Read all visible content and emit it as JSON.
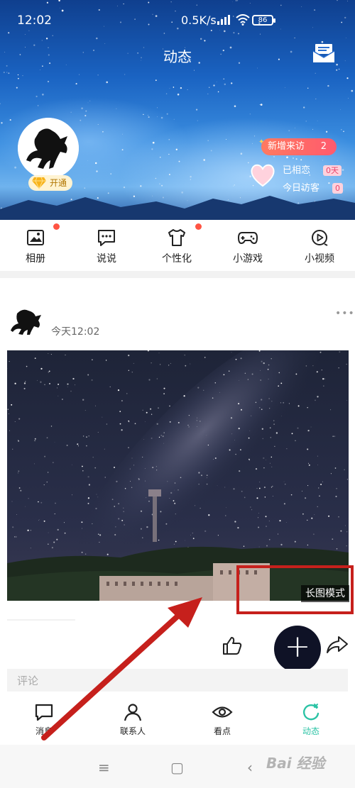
{
  "status_bar": {
    "time": "12:02",
    "net_speed": "0.5K/s",
    "battery": "86"
  },
  "header": {
    "title": "动态",
    "vip_label": "开通",
    "visitor_pill_label": "新增来访",
    "visitor_pill_count": "2",
    "stats": [
      {
        "label": "已相恋",
        "value": "0天"
      },
      {
        "label": "今日访客",
        "value": "0"
      }
    ]
  },
  "shortcuts": [
    {
      "label": "相册",
      "icon": "photo-album-icon",
      "has_dot": true
    },
    {
      "label": "说说",
      "icon": "chat-bubble-icon",
      "has_dot": false
    },
    {
      "label": "个性化",
      "icon": "tshirt-icon",
      "has_dot": true
    },
    {
      "label": "小游戏",
      "icon": "gamepad-icon",
      "has_dot": false
    },
    {
      "label": "小视频",
      "icon": "video-play-icon",
      "has_dot": false
    }
  ],
  "post": {
    "time": "今天12:02",
    "more": "•••",
    "image_tag": "长图模式"
  },
  "comment": {
    "placeholder": "评论"
  },
  "tabbar": [
    {
      "label": "消息",
      "icon": "message-icon",
      "active": false
    },
    {
      "label": "联系人",
      "icon": "contacts-icon",
      "active": false
    },
    {
      "label": "看点",
      "icon": "eye-icon",
      "active": false
    },
    {
      "label": "动态",
      "icon": "refresh-icon",
      "active": true
    }
  ],
  "system_nav": [
    "≡",
    "▢",
    "‹"
  ],
  "watermark": "Bai 经验",
  "colors": {
    "accent": "#2bc3a5",
    "fab": "#0f1226",
    "highlight": "#c6201c",
    "dot": "#ff5443"
  }
}
